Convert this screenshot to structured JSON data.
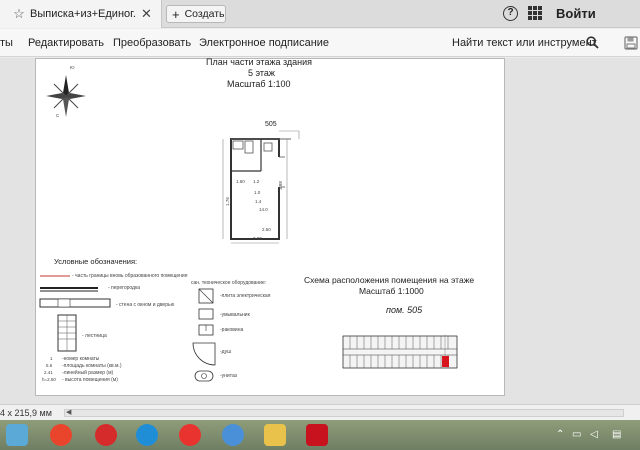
{
  "tabbar": {
    "tab_title": "Выписка+из+Единог...",
    "tab_close": "✕",
    "create_label": "Создать",
    "help_glyph": "?",
    "signin_label": "Войти"
  },
  "toolbar": {
    "items": [
      "ты",
      "Редактировать",
      "Преобразовать",
      "Электронное подписание"
    ],
    "search_label": "Найти текст или инструмент"
  },
  "document": {
    "plan_title_line1": "План части этажа здания",
    "plan_title_line2": "5 этаж",
    "plan_scale": "Масштаб 1:100",
    "room_number_top": "505",
    "compass_n": "Ю",
    "compass_s": "С",
    "dim_labels": [
      "1.60",
      "1.2",
      "1.0",
      "1.76",
      "1.4",
      "3.88",
      "2.50",
      "3.00"
    ],
    "room_area": "14.0",
    "legend_title": "Условные обозначения:",
    "legend_left": [
      "- часть границы вновь образованного помещения",
      "- перегородка",
      "- стена с окном и дверью",
      "- лестница",
      "-номер комнаты",
      "-площадь комнаты (кв.м.)",
      "-линейный размер (м)",
      "- высота помещения (м)"
    ],
    "legend_right_title": "сан. техническое оборудование:",
    "legend_right": [
      "-плита электрическая",
      "-умывальник",
      "-раковина",
      "-душ",
      "-унитаз"
    ],
    "legend_samples": [
      "1",
      "5.6",
      "2.41",
      "h=2.50"
    ],
    "scheme_title": "Схема расположения помещения на этаже",
    "scheme_scale": "Масштаб 1:1000",
    "scheme_room": "пом. 505"
  },
  "statusbar": {
    "size_text": "4 x 215,9 мм",
    "scroll_left": "◀"
  },
  "colors": {
    "highlight_red": "#d8151c",
    "border_red": "#c0392b"
  }
}
